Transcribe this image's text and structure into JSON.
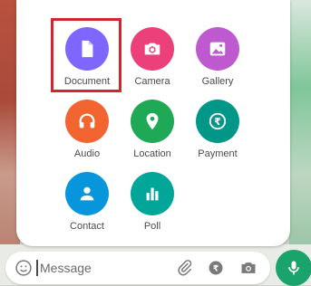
{
  "attach_menu": {
    "items": [
      {
        "label": "Document",
        "icon": "document-icon",
        "color": "#7f66ff"
      },
      {
        "label": "Camera",
        "icon": "camera-icon",
        "color": "#ec407a"
      },
      {
        "label": "Gallery",
        "icon": "gallery-icon",
        "color": "#bf59cf"
      },
      {
        "label": "Audio",
        "icon": "headphones-icon",
        "color": "#f26531"
      },
      {
        "label": "Location",
        "icon": "location-pin-icon",
        "color": "#1fa855"
      },
      {
        "label": "Payment",
        "icon": "rupee-icon",
        "color": "#009688"
      },
      {
        "label": "Contact",
        "icon": "person-icon",
        "color": "#0795dc"
      },
      {
        "label": "Poll",
        "icon": "poll-icon",
        "color": "#02a698"
      }
    ],
    "highlighted": "Document"
  },
  "composer": {
    "placeholder": "Message",
    "icons": [
      "emoji-icon",
      "attach-clip-icon",
      "camera-icon"
    ]
  },
  "colors": {
    "highlight_border": "#d0262f",
    "send_button": "#1aa36a"
  }
}
